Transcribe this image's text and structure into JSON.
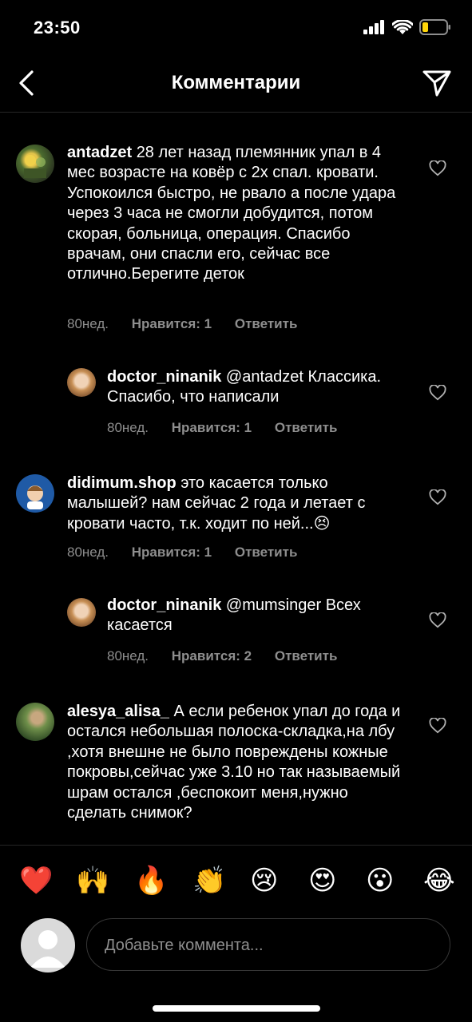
{
  "status": {
    "time": "23:50"
  },
  "header": {
    "title": "Комментарии",
    "back_icon": "chevron-left-icon",
    "share_icon": "paper-plane-icon"
  },
  "comments": [
    {
      "username": "antadzet",
      "text": "28 лет назад племянник упал в 4 мес возрасте на ковёр с 2х спал. кровати. Успокоился быстро, не рвало а после удара через 3 часа не смогли добудится, потом скорая, больница, операция. Спасибо врачам, они спасли его, сейчас все отлично.Берегите деток",
      "time": "80нед.",
      "likes": "Нравится: 1",
      "reply": "Ответить"
    },
    {
      "username": "doctor_ninanik",
      "text": "@antadzet Классика.  Спасибо, что написали",
      "time": "80нед.",
      "likes": "Нравится: 1",
      "reply": "Ответить"
    },
    {
      "username": "didimum.shop",
      "text": "это касается только малышей? нам сейчас 2 года и летает с кровати часто, т.к. ходит по ней...😣",
      "time": "80нед.",
      "likes": "Нравится: 1",
      "reply": "Ответить"
    },
    {
      "username": "doctor_ninanik",
      "text": "@mumsinger Всех касается",
      "time": "80нед.",
      "likes": "Нравится: 2",
      "reply": "Ответить"
    },
    {
      "username": "alesya_alisa_",
      "text": "А если ребенок упал до года и остался небольшая полоска-складка,на лбу ,хотя внешне не было повреждены кожные покровы,сейчас уже 3.10 но так называемый шрам остался ,беспокоит меня,нужно сделать снимок?",
      "time": "",
      "likes": "",
      "reply": ""
    }
  ],
  "emoji_bar": [
    "❤️",
    "🙌",
    "🔥",
    "👏",
    "😢",
    "😍",
    "😮",
    "😂"
  ],
  "composer": {
    "placeholder": "Добавьте коммента..."
  },
  "colors": {
    "background": "#000000",
    "secondary_text": "#8e8e8e",
    "divider": "#262626",
    "heart_red": "#ed4956"
  }
}
